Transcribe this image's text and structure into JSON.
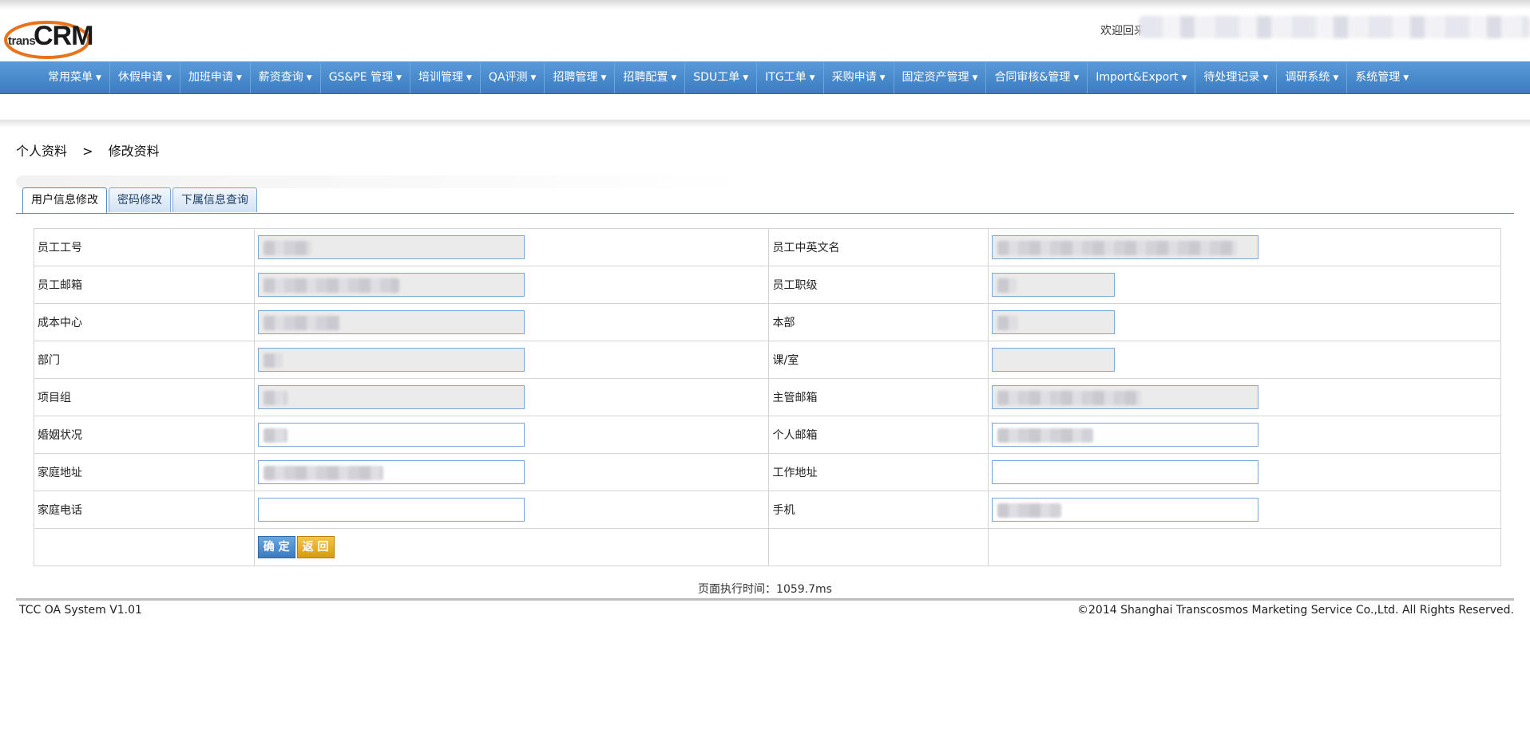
{
  "header": {
    "logo_text_small": "trans",
    "logo_text_big": "CRM",
    "welcome": "欢迎回来"
  },
  "nav": {
    "items": [
      {
        "label": "常用菜单"
      },
      {
        "label": "休假申请"
      },
      {
        "label": "加班申请"
      },
      {
        "label": "薪资查询"
      },
      {
        "label": "GS&PE 管理"
      },
      {
        "label": "培训管理"
      },
      {
        "label": "QA评测"
      },
      {
        "label": "招聘管理"
      },
      {
        "label": "招聘配置"
      },
      {
        "label": "SDU工单"
      },
      {
        "label": "ITG工单"
      },
      {
        "label": "采购申请"
      },
      {
        "label": "固定资产管理"
      },
      {
        "label": "合同审核&管理"
      },
      {
        "label": "Import&Export"
      },
      {
        "label": "待处理记录"
      },
      {
        "label": "调研系统"
      },
      {
        "label": "系统管理"
      }
    ],
    "caret": "▼"
  },
  "breadcrumb": {
    "parent": "个人资料",
    "separator": ">",
    "current": "修改资料"
  },
  "tabs": [
    {
      "label": "用户信息修改",
      "active": true
    },
    {
      "label": "密码修改",
      "active": false
    },
    {
      "label": "下属信息查询",
      "active": false
    }
  ],
  "form": {
    "rows": [
      {
        "left_label": "员工工号",
        "right_label": "员工中英文名"
      },
      {
        "left_label": "员工邮箱",
        "right_label": "员工职级"
      },
      {
        "left_label": "成本中心",
        "right_label": "本部"
      },
      {
        "left_label": "部门",
        "right_label": "课/室"
      },
      {
        "left_label": "项目组",
        "right_label": "主管邮箱"
      },
      {
        "left_label": "婚姻状况",
        "right_label": "个人邮箱"
      },
      {
        "left_label": "家庭地址",
        "right_label": "工作地址"
      },
      {
        "left_label": "家庭电话",
        "right_label": "手机"
      }
    ],
    "ok_label": "确 定",
    "back_label": "返 回"
  },
  "exec_time": "页面执行时间：1059.7ms",
  "footer": {
    "left": "TCC OA System V1.01",
    "right": "©2014 Shanghai Transcosmos Marketing Service Co.,Ltd. All Rights Reserved."
  },
  "colors": {
    "nav_bg": "#4a8bcd",
    "input_border": "#7aa7d8",
    "ok_button": "#3a7cc2",
    "back_button": "#e0a820"
  }
}
